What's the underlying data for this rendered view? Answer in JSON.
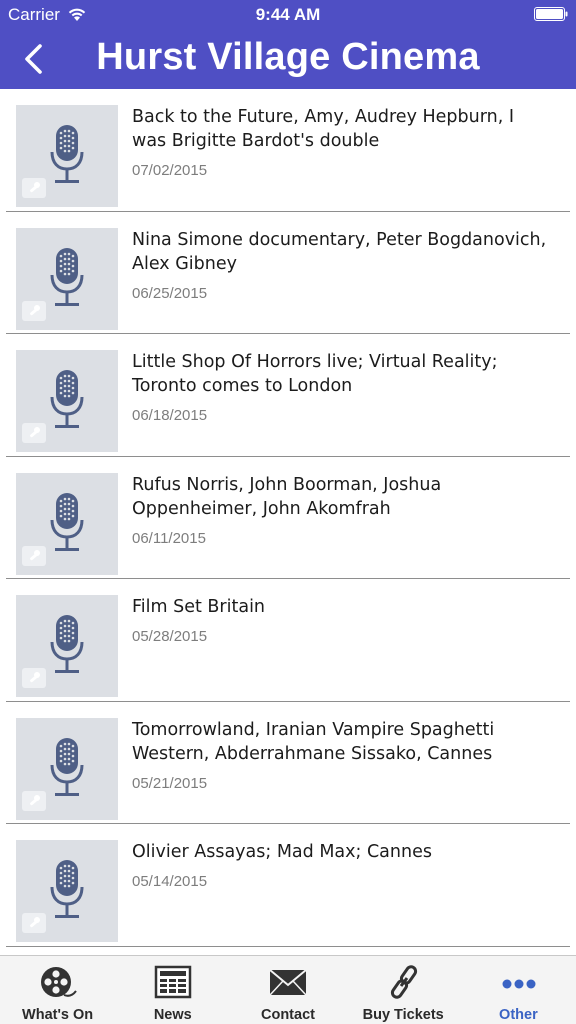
{
  "status_bar": {
    "carrier": "Carrier",
    "time": "9:44 AM"
  },
  "header": {
    "title": "Hurst Village Cinema",
    "back_icon": "chevron-left-icon",
    "color": "#4f4fc4"
  },
  "items": [
    {
      "title": "Back to the Future, Amy, Audrey Hepburn, I was Brigitte Bardot's double",
      "date": "07/02/2015",
      "icon": "microphone-icon"
    },
    {
      "title": "Nina Simone documentary, Peter Bogdanovich, Alex Gibney",
      "date": "06/25/2015",
      "icon": "microphone-icon"
    },
    {
      "title": "Little Shop Of Horrors live; Virtual Reality; Toronto comes to London",
      "date": "06/18/2015",
      "icon": "microphone-icon"
    },
    {
      "title": "Rufus Norris, John Boorman, Joshua Oppenheimer, John Akomfrah",
      "date": "06/11/2015",
      "icon": "microphone-icon"
    },
    {
      "title": "Film Set Britain",
      "date": "05/28/2015",
      "icon": "microphone-icon"
    },
    {
      "title": "Tomorrowland, Iranian Vampire Spaghetti Western, Abderrahmane Sissako, Cannes",
      "date": "05/21/2015",
      "icon": "microphone-icon"
    },
    {
      "title": "Olivier Assayas; Mad Max; Cannes",
      "date": "05/14/2015",
      "icon": "microphone-icon"
    }
  ],
  "tabs": [
    {
      "label": "What's On",
      "icon": "film-reel-icon"
    },
    {
      "label": "News",
      "icon": "newspaper-icon"
    },
    {
      "label": "Contact",
      "icon": "envelope-icon"
    },
    {
      "label": "Buy Tickets",
      "icon": "chain-link-icon"
    },
    {
      "label": "Other",
      "icon": "more-dots-icon",
      "active": true,
      "active_color": "#3a63c4"
    }
  ]
}
